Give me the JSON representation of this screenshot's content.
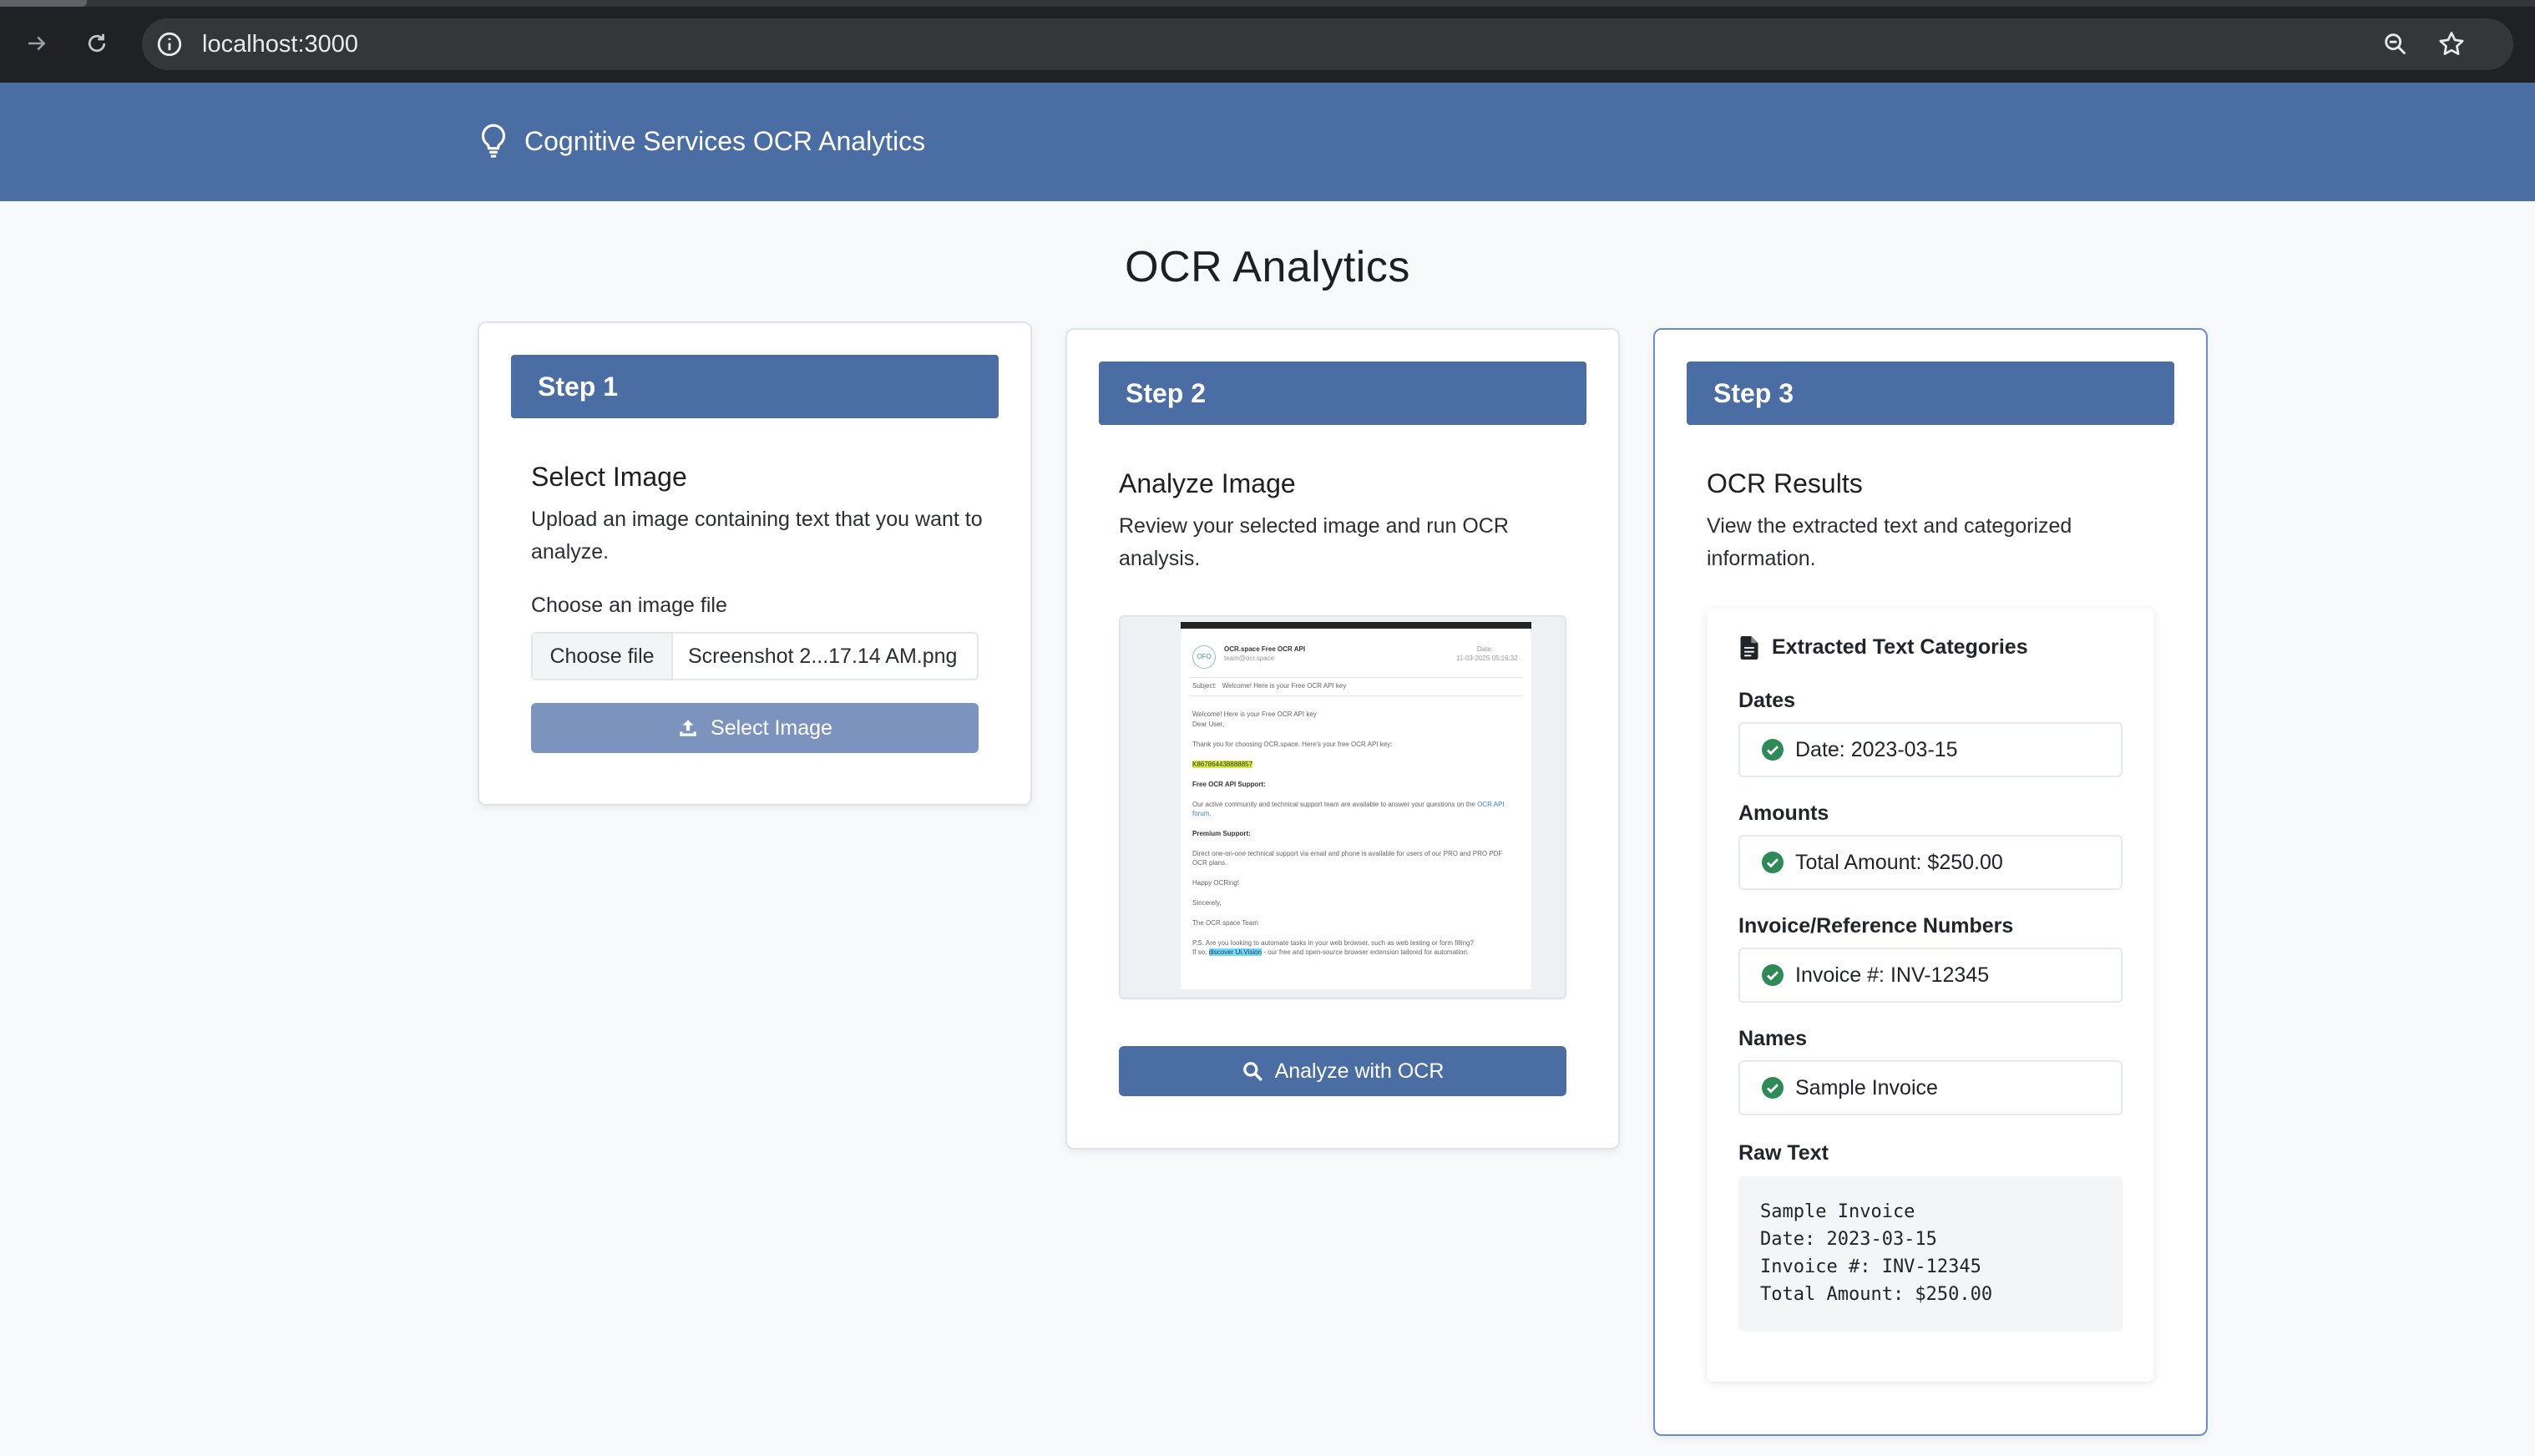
{
  "browser": {
    "url": "localhost:3000"
  },
  "app": {
    "brand": "Cognitive Services OCR Analytics",
    "page_title": "OCR Analytics"
  },
  "step1": {
    "header": "Step 1",
    "title": "Select Image",
    "description": "Upload an image containing text that you want to analyze.",
    "file_label": "Choose an image file",
    "choose_button": "Choose file",
    "file_name": "Screenshot 2...17.14 AM.png",
    "select_button": "Select Image"
  },
  "step2": {
    "header": "Step 2",
    "title": "Analyze Image",
    "description": "Review your selected image and run OCR analysis.",
    "analyze_button": "Analyze with OCR"
  },
  "step3": {
    "header": "Step 3",
    "title": "OCR Results",
    "description": "View the extracted text and categorized information.",
    "results_title": "Extracted Text Categories",
    "categories": [
      {
        "label": "Dates",
        "value": "Date: 2023-03-15"
      },
      {
        "label": "Amounts",
        "value": "Total Amount: $250.00"
      },
      {
        "label": "Invoice/Reference Numbers",
        "value": "Invoice #: INV-12345"
      },
      {
        "label": "Names",
        "value": "Sample Invoice"
      }
    ],
    "raw_label": "Raw Text",
    "raw_text": "Sample Invoice\nDate: 2023-03-15\nInvoice #: INV-12345\nTotal Amount: $250.00"
  },
  "colors": {
    "primary": "#4a6da3",
    "success": "#2e8b57",
    "background": "#f8f9fb"
  }
}
